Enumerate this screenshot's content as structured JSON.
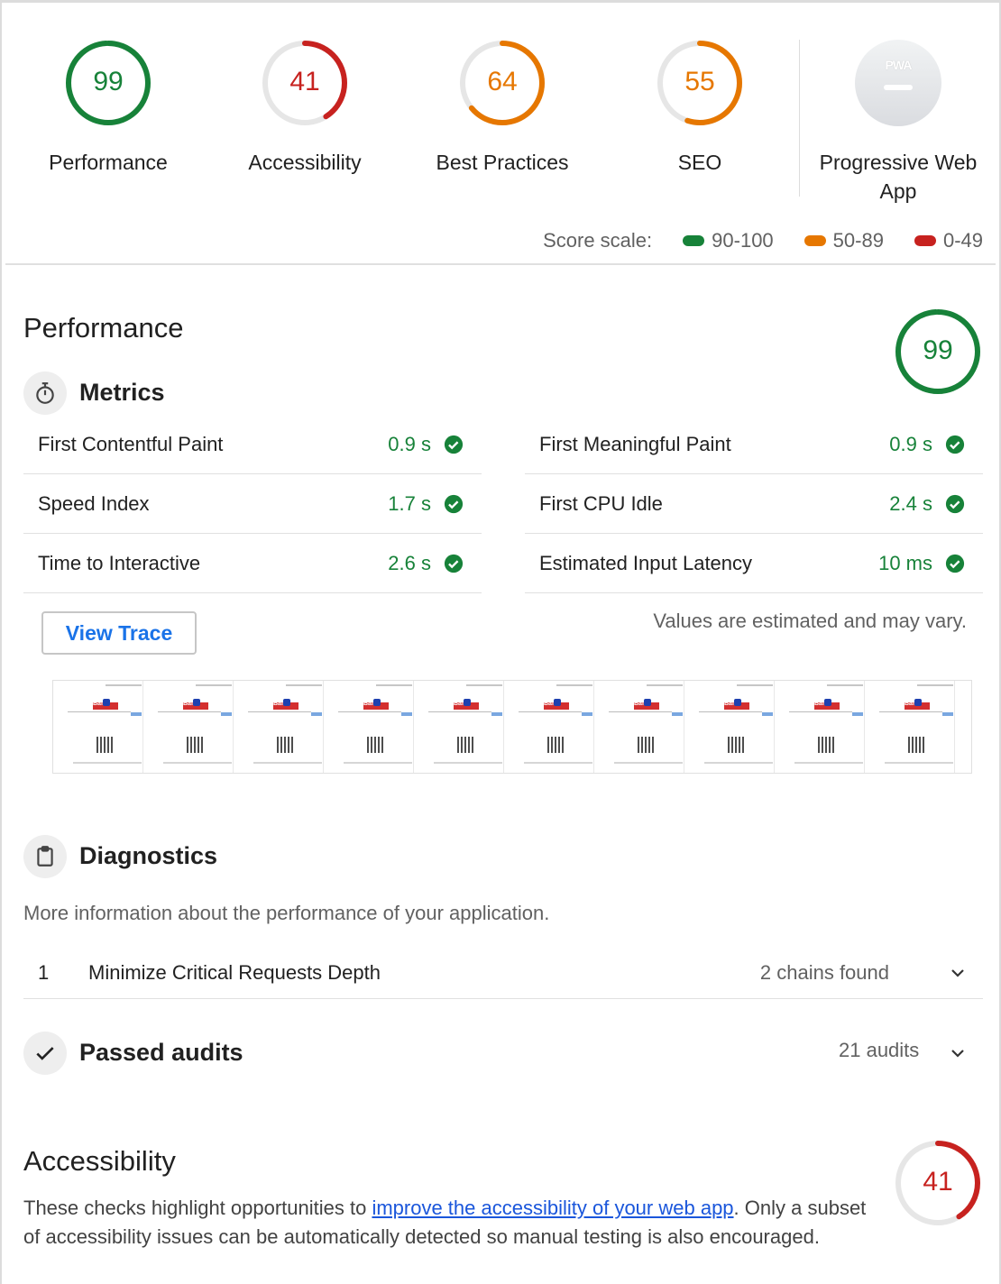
{
  "colors": {
    "pass": "#178239",
    "average": "#e67700",
    "fail": "#c7221f",
    "link": "#1a56db"
  },
  "summary": {
    "categories": [
      {
        "score": "99",
        "label": "Performance",
        "fraction": 0.99,
        "color": "#178239"
      },
      {
        "score": "41",
        "label": "Accessibility",
        "fraction": 0.41,
        "color": "#c7221f"
      },
      {
        "score": "64",
        "label": "Best Practices",
        "fraction": 0.64,
        "color": "#e67700"
      },
      {
        "score": "55",
        "label": "SEO",
        "fraction": 0.55,
        "color": "#e67700"
      }
    ],
    "pwa": {
      "badge": "PWA",
      "label_line1": "Progressive Web",
      "label_line2": "App"
    }
  },
  "scale": {
    "label": "Score scale:",
    "pass": "90-100",
    "average": "50-89",
    "fail": "0-49"
  },
  "performance": {
    "title": "Performance",
    "score": "99",
    "fraction": 0.99,
    "metrics_title": "Metrics",
    "metrics": [
      {
        "name": "First Contentful Paint",
        "value": "0.9 s"
      },
      {
        "name": "First Meaningful Paint",
        "value": "0.9 s"
      },
      {
        "name": "Speed Index",
        "value": "1.7 s"
      },
      {
        "name": "First CPU Idle",
        "value": "2.4 s"
      },
      {
        "name": "Time to Interactive",
        "value": "2.6 s"
      },
      {
        "name": "Estimated Input Latency",
        "value": "10 ms"
      }
    ],
    "view_trace": "View Trace",
    "estimate_note": "Values are estimated and may vary.",
    "thumbnail_logo": "Bai",
    "diagnostics_title": "Diagnostics",
    "diagnostics_desc": "More information about the performance of your application.",
    "diagnostics_items": [
      {
        "index": "1",
        "title": "Minimize Critical Requests Depth",
        "display": "2 chains found"
      }
    ],
    "passed_title": "Passed audits",
    "passed_count": "21 audits"
  },
  "accessibility": {
    "title": "Accessibility",
    "score": "41",
    "fraction": 0.41,
    "desc_before": "These checks highlight opportunities to ",
    "desc_link": "improve the accessibility of your web app",
    "desc_after": ". Only a subset of accessibility issues can be automatically detected so manual testing is also encouraged."
  }
}
